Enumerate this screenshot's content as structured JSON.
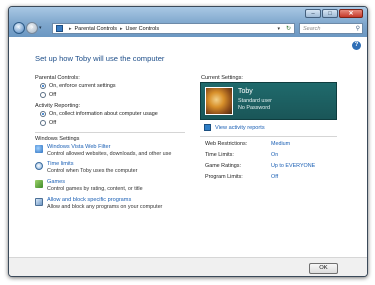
{
  "address": {
    "crumbs": [
      "Parental Controls",
      "User Controls"
    ]
  },
  "search": {
    "placeholder": "Search"
  },
  "page": {
    "title": "Set up how Toby will use the computer"
  },
  "parental_controls": {
    "label": "Parental Controls:",
    "options": [
      "On, enforce current settings",
      "Off"
    ],
    "selected": "On, enforce current settings"
  },
  "activity_reporting": {
    "label": "Activity Reporting:",
    "options": [
      "On, collect information about computer usage",
      "Off"
    ],
    "selected": "On, collect information about computer usage"
  },
  "windows_settings": {
    "label": "Windows Settings",
    "items": [
      {
        "link": "Windows Vista Web Filter",
        "desc": "Control allowed websites, downloads, and other use",
        "icon": "globe-icon"
      },
      {
        "link": "Time limits",
        "desc": "Control when Toby uses the computer",
        "icon": "clock-icon"
      },
      {
        "link": "Games",
        "desc": "Control games by rating, content, or title",
        "icon": "games-icon"
      },
      {
        "link": "Allow and block specific programs",
        "desc": "Allow and block any programs on your computer",
        "icon": "programs-icon"
      }
    ]
  },
  "current_settings": {
    "label": "Current Settings:",
    "user": {
      "name": "Toby",
      "account_type": "Standard user",
      "password": "No Password"
    },
    "view_reports": "View activity reports",
    "rows": [
      {
        "key": "Web Restrictions:",
        "value": "Medium"
      },
      {
        "key": "Time Limits:",
        "value": "On"
      },
      {
        "key": "Game Ratings:",
        "value": "Up to EVERYONE"
      },
      {
        "key": "Program Limits:",
        "value": "Off"
      }
    ]
  },
  "footer": {
    "ok_label": "OK"
  },
  "colors": {
    "link": "#1a5fb4",
    "title": "#1f4f8a",
    "user_panel": "#1f6a6c"
  }
}
